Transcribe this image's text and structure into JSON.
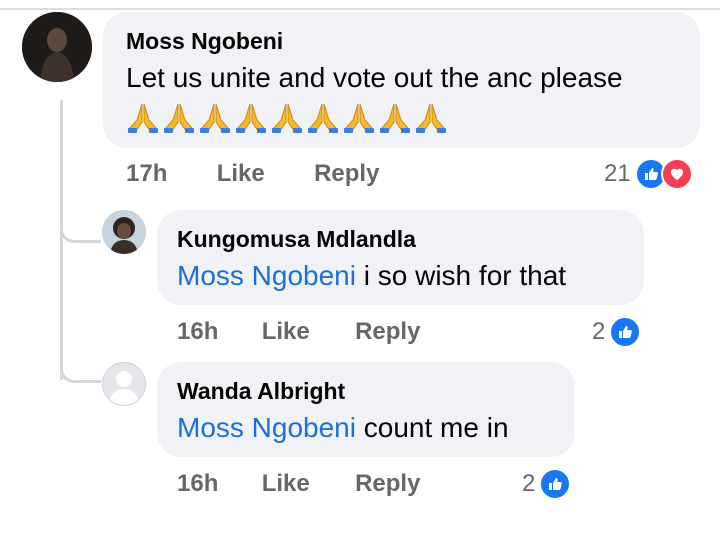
{
  "comments": [
    {
      "author": "Moss Ngobeni",
      "text": "Let us unite and vote out the anc please",
      "emoji_count": 9,
      "time": "17h",
      "like_label": "Like",
      "reply_label": "Reply",
      "reaction_count": "21",
      "reactions": [
        "like-icon",
        "love-icon"
      ]
    },
    {
      "author": "Kungomusa Mdlandla",
      "mention": "Moss Ngobeni",
      "text": "i so wish for that",
      "time": "16h",
      "like_label": "Like",
      "reply_label": "Reply",
      "reaction_count": "2",
      "reactions": [
        "like-icon"
      ]
    },
    {
      "author": "Wanda Albright",
      "mention": "Moss Ngobeni",
      "text": "count me in",
      "time": "16h",
      "like_label": "Like",
      "reply_label": "Reply",
      "reaction_count": "2",
      "reactions": [
        "like-icon"
      ]
    }
  ],
  "colors": {
    "bubble": "#f0f2f5",
    "mention": "#1c6fd8",
    "like": "#1877f2",
    "love": "#f33e58"
  }
}
